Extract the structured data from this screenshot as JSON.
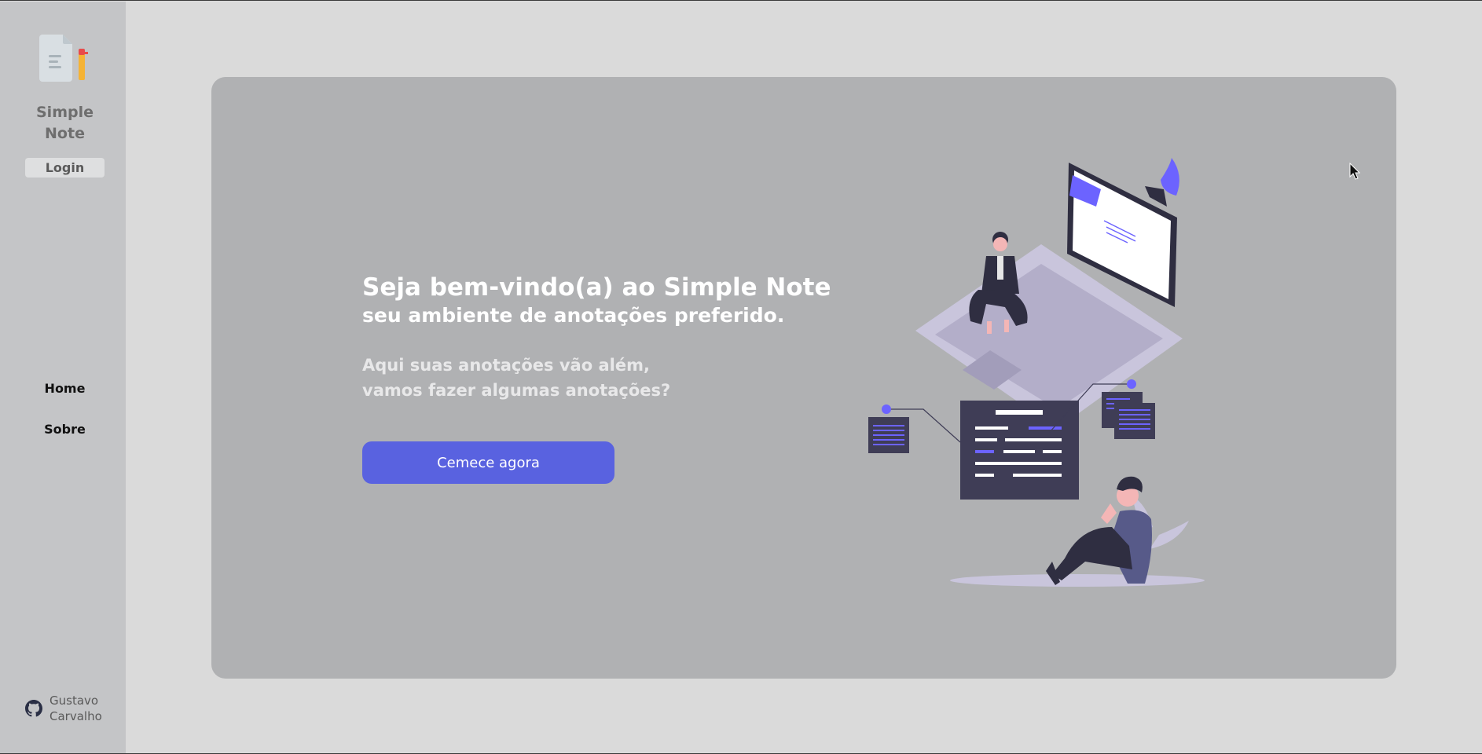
{
  "sidebar": {
    "app_title_line1": "Simple",
    "app_title_line2": "Note",
    "login_label": "Login",
    "nav": [
      {
        "label": "Home"
      },
      {
        "label": "Sobre"
      }
    ],
    "author_line1": "Gustavo",
    "author_line2": "Carvalho",
    "author_icon": "github-icon"
  },
  "hero": {
    "title": "Seja bem-vindo(a) ao Simple Note",
    "subtitle": "seu ambiente de anotações preferido.",
    "desc_line1": "Aqui suas anotações vão além,",
    "desc_line2": "vamos fazer algumas anotações?",
    "cta_label": "Cemece agora"
  },
  "colors": {
    "accent": "#5962e0",
    "illustration_accent": "#6c63ff",
    "sidebar_bg": "#c4c5c7",
    "hero_bg": "#b0b1b3",
    "page_bg": "#dadada"
  }
}
